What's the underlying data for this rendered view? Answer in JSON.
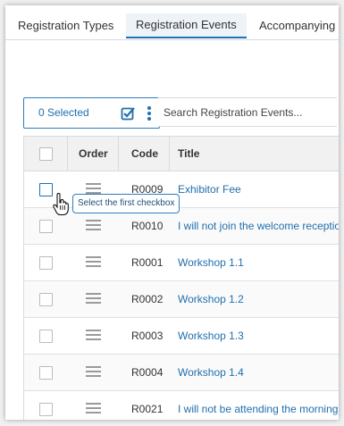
{
  "tabs": [
    {
      "label": "Registration Types",
      "active": false
    },
    {
      "label": "Registration Events",
      "active": true
    },
    {
      "label": "Accompanying P",
      "active": false
    }
  ],
  "toolbar": {
    "selected_label": "0 Selected",
    "search_placeholder": "Search Registration Events..."
  },
  "table": {
    "headers": {
      "order": "Order",
      "code": "Code",
      "title": "Title"
    },
    "rows": [
      {
        "code": "R0009",
        "title": "Exhibitor Fee"
      },
      {
        "code": "R0010",
        "title": "I will not join the welcome reception"
      },
      {
        "code": "R0001",
        "title": "Workshop 1.1"
      },
      {
        "code": "R0002",
        "title": "Workshop 1.2"
      },
      {
        "code": "R0003",
        "title": "Workshop 1.3"
      },
      {
        "code": "R0004",
        "title": "Workshop 1.4"
      },
      {
        "code": "R0021",
        "title": "I will not be attending the morning session"
      }
    ]
  },
  "tooltip": {
    "text": "Select the first checkbox"
  },
  "colors": {
    "accent": "#1f6fae",
    "link": "#1f6fae"
  }
}
